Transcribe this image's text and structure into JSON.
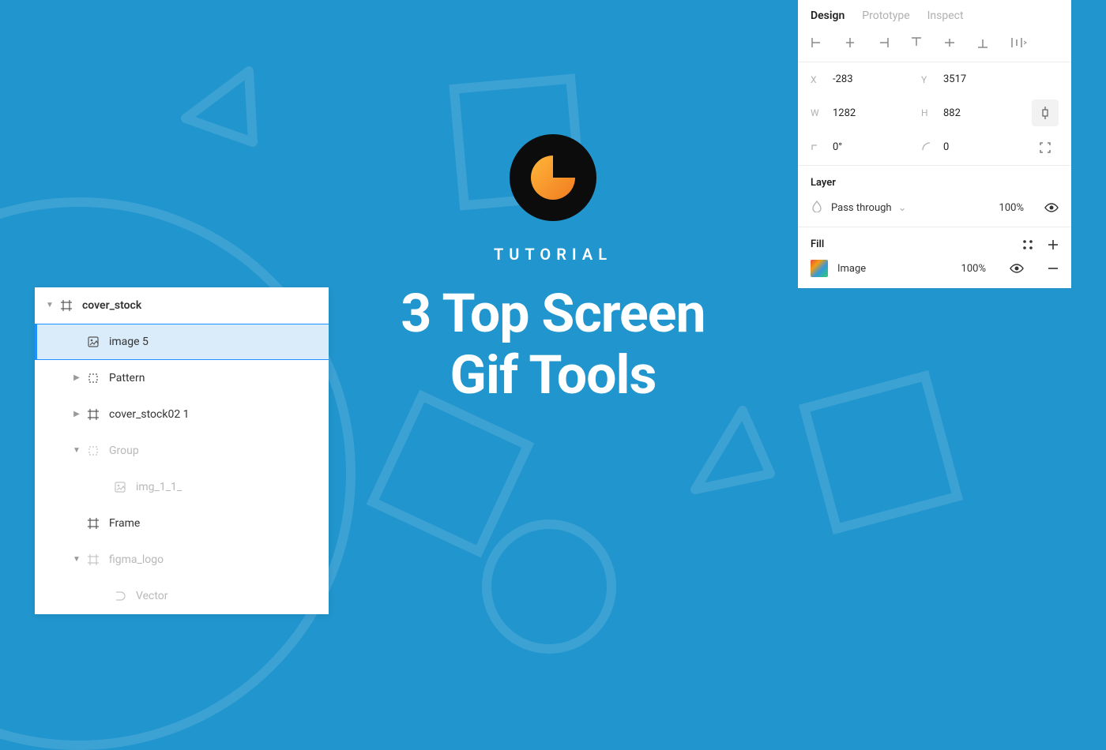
{
  "hero": {
    "subtitle": "TUTORIAL",
    "title_l1": "3 Top Screen",
    "title_l2": "Gif Tools"
  },
  "layers": {
    "items": [
      {
        "label": "cover_stock",
        "indent": 0,
        "chevron": "down",
        "icon": "frame",
        "bold": true
      },
      {
        "label": "image 5",
        "indent": 1,
        "icon": "image",
        "highlighted": true
      },
      {
        "label": "Pattern",
        "indent": 1,
        "chevron": "right",
        "icon": "group"
      },
      {
        "label": "cover_stock02 1",
        "indent": 1,
        "chevron": "right",
        "icon": "frame"
      },
      {
        "label": "Group",
        "indent": 1,
        "chevron": "down",
        "icon": "group",
        "dim": true
      },
      {
        "label": "img_1_1_",
        "indent": 2,
        "icon": "image",
        "dim": true
      },
      {
        "label": "Frame",
        "indent": 1,
        "icon": "frame"
      },
      {
        "label": "figma_logo",
        "indent": 1,
        "chevron": "down",
        "icon": "frame",
        "dim": true
      },
      {
        "label": "Vector",
        "indent": 2,
        "icon": "vector",
        "dim": true
      }
    ]
  },
  "inspector": {
    "tabs": {
      "design": "Design",
      "prototype": "Prototype",
      "inspect": "Inspect"
    },
    "position": {
      "x_label": "X",
      "x": "-283",
      "y_label": "Y",
      "y": "3517",
      "w_label": "W",
      "w": "1282",
      "h_label": "H",
      "h": "882",
      "rotation": "0°",
      "radius": "0"
    },
    "layer": {
      "title": "Layer",
      "mode": "Pass through",
      "opacity": "100%"
    },
    "fill": {
      "title": "Fill",
      "type": "Image",
      "opacity": "100%"
    }
  }
}
